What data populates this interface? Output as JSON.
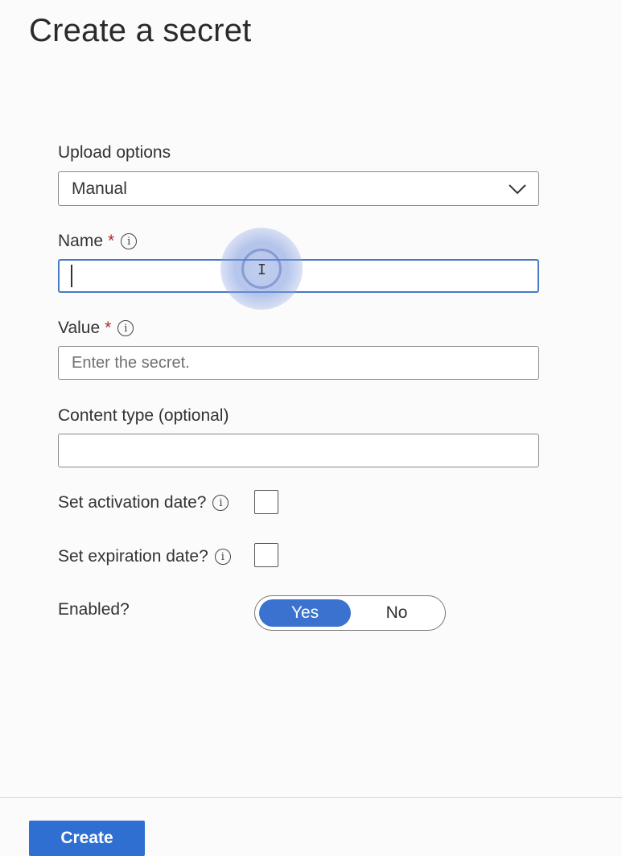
{
  "page": {
    "title": "Create a secret"
  },
  "form": {
    "upload_options": {
      "label": "Upload options",
      "selected": "Manual"
    },
    "name": {
      "label": "Name",
      "required_marker": "*",
      "value": "",
      "placeholder": ""
    },
    "value": {
      "label": "Value",
      "required_marker": "*",
      "value": "",
      "placeholder": "Enter the secret."
    },
    "content_type": {
      "label": "Content type (optional)",
      "value": ""
    },
    "activation_date": {
      "label": "Set activation date?",
      "checked": false
    },
    "expiration_date": {
      "label": "Set expiration date?",
      "checked": false
    },
    "enabled": {
      "label": "Enabled?",
      "options": [
        "Yes",
        "No"
      ],
      "selected": "Yes"
    }
  },
  "footer": {
    "create_label": "Create"
  },
  "icons": {
    "info": "info-icon",
    "dropdown": "chevron-down-icon",
    "cursor": "ibeam-cursor-icon"
  },
  "colors": {
    "accent": "#2f6fd1",
    "toggle_selected": "#3b72cf",
    "focus_border": "#4a78c2",
    "required": "#b4252a"
  }
}
